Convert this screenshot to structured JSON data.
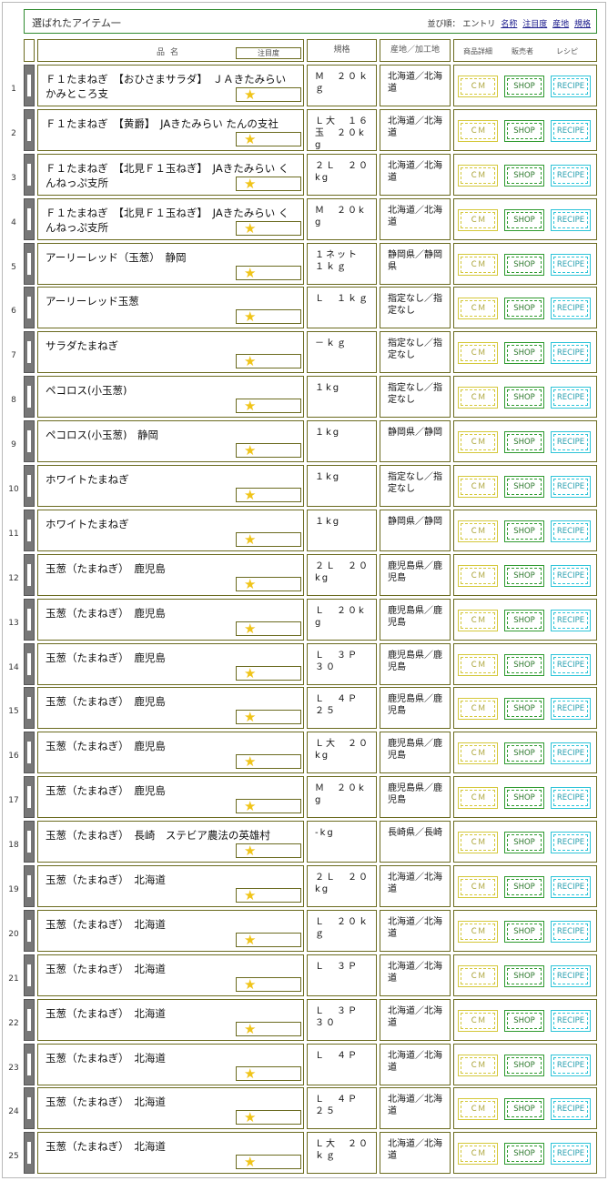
{
  "header": {
    "title": "選ばれたアイテム一",
    "sort_label": "並び順：",
    "sort_options": [
      "エントリ",
      "名称",
      "注目度",
      "産地",
      "規格"
    ]
  },
  "columns": {
    "name": "品名",
    "attention": "注目度",
    "spec": "規格",
    "origin": "産地／加工地",
    "detail": "商品詳細",
    "seller": "販売者",
    "recipe": "レシピ"
  },
  "buttons": {
    "cm": "ＣＭ",
    "shop": "SHOP",
    "recipe": "RECIPE"
  },
  "star_icon": "★",
  "rows": [
    {
      "no": "1",
      "name": "Ｆ１たまねぎ　【おひさまサラダ】　ＪＡきたみらい かみところ支",
      "spec": "Ｍ　２０ｋｇ",
      "origin": "北海道／北海道",
      "stars": 1
    },
    {
      "no": "2",
      "name": "Ｆ１たまねぎ　【黄爵】　JAきたみらい たんの支社",
      "spec": "Ｌ大　１６玉　２０kg",
      "origin": "北海道／北海道",
      "stars": 1
    },
    {
      "no": "3",
      "name": "Ｆ１たまねぎ　【北見Ｆ１玉ねぎ】　JAきたみらい くんねっぷ支所",
      "spec": "２Ｌ　２０kg",
      "origin": "北海道／北海道",
      "stars": 1
    },
    {
      "no": "4",
      "name": "Ｆ１たまねぎ　【北見Ｆ１玉ねぎ】　JAきたみらい くんねっぷ支所",
      "spec": "Ｍ　２０kg",
      "origin": "北海道／北海道",
      "stars": 1
    },
    {
      "no": "5",
      "name": "アーリーレッド（玉葱）　静岡",
      "spec": "１ネット　１ｋｇ",
      "origin": "静岡県／静岡県",
      "stars": 1
    },
    {
      "no": "6",
      "name": "アーリーレッド玉葱",
      "spec": "Ｌ　１ｋｇ",
      "origin": "指定なし／指定なし",
      "stars": 1
    },
    {
      "no": "7",
      "name": "サラダたまねぎ",
      "spec": "－ｋｇ",
      "origin": "指定なし／指定なし",
      "stars": 1
    },
    {
      "no": "8",
      "name": "ペコロス(小玉葱)",
      "spec": "１kg",
      "origin": "指定なし／指定なし",
      "stars": 1
    },
    {
      "no": "9",
      "name": "ペコロス(小玉葱)　静岡",
      "spec": "１kg",
      "origin": "静岡県／静岡",
      "stars": 1
    },
    {
      "no": "10",
      "name": "ホワイトたまねぎ",
      "spec": "１kg",
      "origin": "指定なし／指定なし",
      "stars": 1
    },
    {
      "no": "11",
      "name": "ホワイトたまねぎ",
      "spec": "１kg",
      "origin": "静岡県／静岡",
      "stars": 1
    },
    {
      "no": "12",
      "name": "玉葱（たまねぎ）　鹿児島",
      "spec": "２Ｌ　２０kg",
      "origin": "鹿児島県／鹿児島",
      "stars": 1
    },
    {
      "no": "13",
      "name": "玉葱（たまねぎ）　鹿児島",
      "spec": "Ｌ　２０kg",
      "origin": "鹿児島県／鹿児島",
      "stars": 1
    },
    {
      "no": "14",
      "name": "玉葱（たまねぎ）　鹿児島",
      "spec": "Ｌ　３Ｐ　３０",
      "origin": "鹿児島県／鹿児島",
      "stars": 1
    },
    {
      "no": "15",
      "name": "玉葱（たまねぎ）　鹿児島",
      "spec": "Ｌ　４Ｐ　２５",
      "origin": "鹿児島県／鹿児島",
      "stars": 1
    },
    {
      "no": "16",
      "name": "玉葱（たまねぎ）　鹿児島",
      "spec": "Ｌ大　２０kg",
      "origin": "鹿児島県／鹿児島",
      "stars": 1
    },
    {
      "no": "17",
      "name": "玉葱（たまねぎ）　鹿児島",
      "spec": "Ｍ　２０kg",
      "origin": "鹿児島県／鹿児島",
      "stars": 1
    },
    {
      "no": "18",
      "name": "玉葱（たまねぎ）　長崎　ステビア農法の英雄村",
      "spec": "-kg",
      "origin": "長崎県／長崎",
      "stars": 1
    },
    {
      "no": "19",
      "name": "玉葱（たまねぎ）　北海道",
      "spec": "２Ｌ　２０kg",
      "origin": "北海道／北海道",
      "stars": 1
    },
    {
      "no": "20",
      "name": "玉葱（たまねぎ）　北海道",
      "spec": "Ｌ　２０ｋｇ",
      "origin": "北海道／北海道",
      "stars": 1
    },
    {
      "no": "21",
      "name": "玉葱（たまねぎ）　北海道",
      "spec": "Ｌ　３Ｐ",
      "origin": "北海道／北海道",
      "stars": 1
    },
    {
      "no": "22",
      "name": "玉葱（たまねぎ）　北海道",
      "spec": "Ｌ　３Ｐ　３０",
      "origin": "北海道／北海道",
      "stars": 1
    },
    {
      "no": "23",
      "name": "玉葱（たまねぎ）　北海道",
      "spec": "Ｌ　４Ｐ",
      "origin": "北海道／北海道",
      "stars": 1
    },
    {
      "no": "24",
      "name": "玉葱（たまねぎ）　北海道",
      "spec": "Ｌ　４Ｐ　２５",
      "origin": "北海道／北海道",
      "stars": 1
    },
    {
      "no": "25",
      "name": "玉葱（たまねぎ）　北海道",
      "spec": "Ｌ大　２０ｋｇ",
      "origin": "北海道／北海道",
      "stars": 1
    }
  ]
}
